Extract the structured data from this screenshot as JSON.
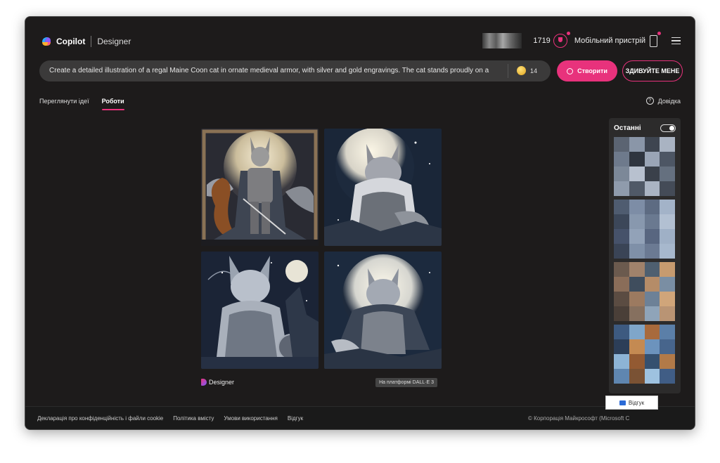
{
  "header": {
    "brand_primary": "Copilot",
    "brand_secondary": "Designer",
    "points": "1719",
    "mobile_label": "Мобільний пристрій"
  },
  "prompt": {
    "text": "Create a detailed illustration of a regal Maine Coon cat in ornate medieval armor, with silver and gold engravings. The cat stands proudly on a ro",
    "boosts": "14",
    "create_label": "Створити",
    "surprise_label": "ЗДИВУЙТЕ МЕНЕ"
  },
  "tabs": [
    {
      "label": "Переглянути ідеї",
      "active": false
    },
    {
      "label": "Роботи",
      "active": true
    }
  ],
  "help_label": "Довідка",
  "results": {
    "designer_mark": "Designer",
    "badge": "На платформі DALL·E 3",
    "images": [
      {
        "icon": "cat-knight-standing-image"
      },
      {
        "icon": "cat-armor-moon-image"
      },
      {
        "icon": "cat-armor-night-image"
      },
      {
        "icon": "cat-armor-cape-image"
      }
    ]
  },
  "recent": {
    "title": "Останні",
    "palettes": [
      [
        "#5b6472",
        "#8a96a8",
        "#3e4550",
        "#a9b3c2",
        "#6e7a8c",
        "#2f353f",
        "#9aa5b6",
        "#4d5664",
        "#7c8898",
        "#b8c1cf",
        "#3a404a",
        "#65707f",
        "#8f9bac",
        "#505967",
        "#aab4c3",
        "#444b57"
      ],
      [
        "#4f5c70",
        "#7d8da6",
        "#5d6b82",
        "#a3b3c8",
        "#3c4759",
        "#8898ae",
        "#6a7990",
        "#b2c0d2",
        "#46526a",
        "#92a2b8",
        "#586680",
        "#9fb0c6",
        "#3a4456",
        "#7f90a8",
        "#6b7a93",
        "#a7b8cd"
      ],
      [
        "#6b5a4e",
        "#a0826b",
        "#4e5f70",
        "#c79b6f",
        "#8a6d59",
        "#3f4d5d",
        "#b58c68",
        "#7a8ea3",
        "#5b4c42",
        "#9c7a60",
        "#6d8197",
        "#d0a57a",
        "#4a3f38",
        "#86705f",
        "#8fa4b9",
        "#b99474"
      ],
      [
        "#3d5a80",
        "#7fa6c9",
        "#a86a3c",
        "#5b7fa8",
        "#2c3e58",
        "#c48a52",
        "#6c93bd",
        "#47658c",
        "#8db4d6",
        "#935a32",
        "#35506f",
        "#b27a48",
        "#5f86b0",
        "#7a5234",
        "#9ec2e0",
        "#405d85"
      ]
    ]
  },
  "footer": {
    "links": [
      "Декларація про конфіденційність і файли cookie",
      "Політика вмісту",
      "Умови використання",
      "Відгук"
    ],
    "copyright": "© Корпорація Майкрософт (Microsoft C",
    "feedback_label": "Відгук"
  }
}
